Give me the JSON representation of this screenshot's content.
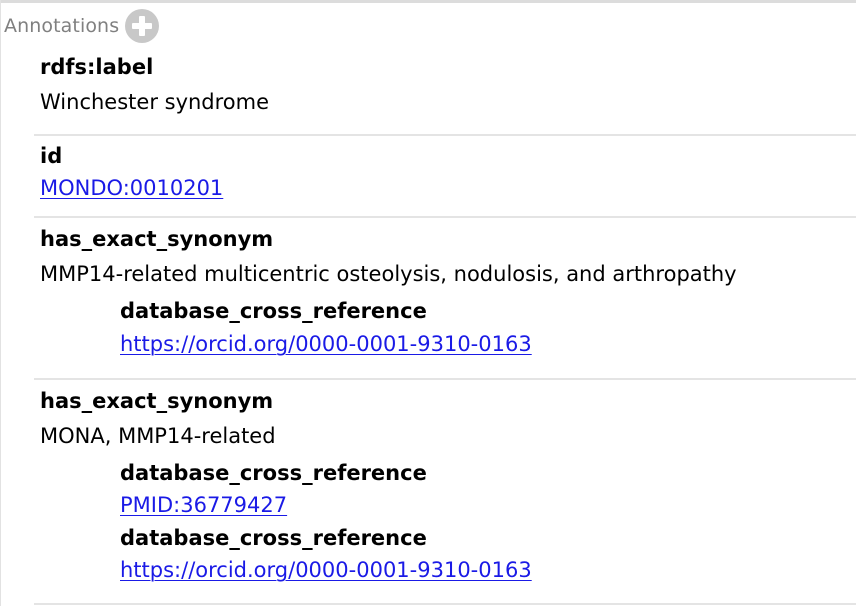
{
  "header": {
    "title": "Annotations",
    "add_icon": "plus-circle-icon"
  },
  "annotations": [
    {
      "property": "rdfs:label",
      "value": "Winchester syndrome"
    },
    {
      "property": "id",
      "value": "MONDO:0010201",
      "is_link": true
    },
    {
      "property": "has_exact_synonym",
      "value": "MMP14-related multicentric osteolysis, nodulosis, and arthropathy",
      "sub": [
        {
          "property": "database_cross_reference",
          "value": "https://orcid.org/0000-0001-9310-0163",
          "is_link": true
        }
      ]
    },
    {
      "property": "has_exact_synonym",
      "value": "MONA, MMP14-related",
      "sub": [
        {
          "property": "database_cross_reference",
          "value": "PMID:36779427",
          "is_link": true
        },
        {
          "property": "database_cross_reference",
          "value": "https://orcid.org/0000-0001-9310-0163",
          "is_link": true
        }
      ]
    }
  ],
  "colors": {
    "link": "#1a1ae6",
    "header_text": "#808080",
    "divider": "#e4e4e4"
  }
}
